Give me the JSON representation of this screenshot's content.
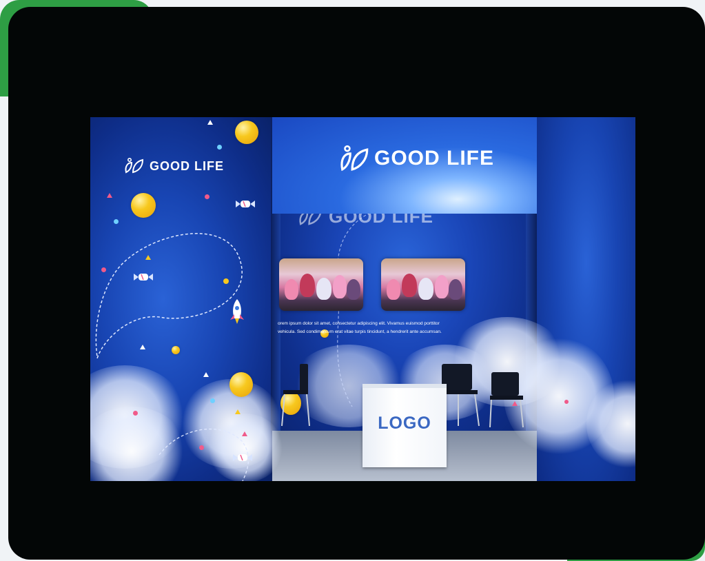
{
  "booth": {
    "brand_left": "GOOD LIFE",
    "brand_header": "GOOD LIFE",
    "brand_back_wall": "GOOD LIFE",
    "body_line_1": "orem ipsum dolor sit amet, consectetur adipiscing elit. Vivamus euismod porttitor",
    "body_line_2": "vehicula. Sed condimentum erat vitae turpis tincidunt, a hendrerit ante accumsan.",
    "desk_logo": "LOGO"
  },
  "colors": {
    "accent_green": "#2e9e44",
    "frame_black": "#030606",
    "wall_blue": "#1a46b8",
    "logo_blue": "#3b68c2"
  },
  "icons": [
    "leaf-logo-icon",
    "rocket-icon",
    "balloon-icon",
    "candy-icon"
  ]
}
